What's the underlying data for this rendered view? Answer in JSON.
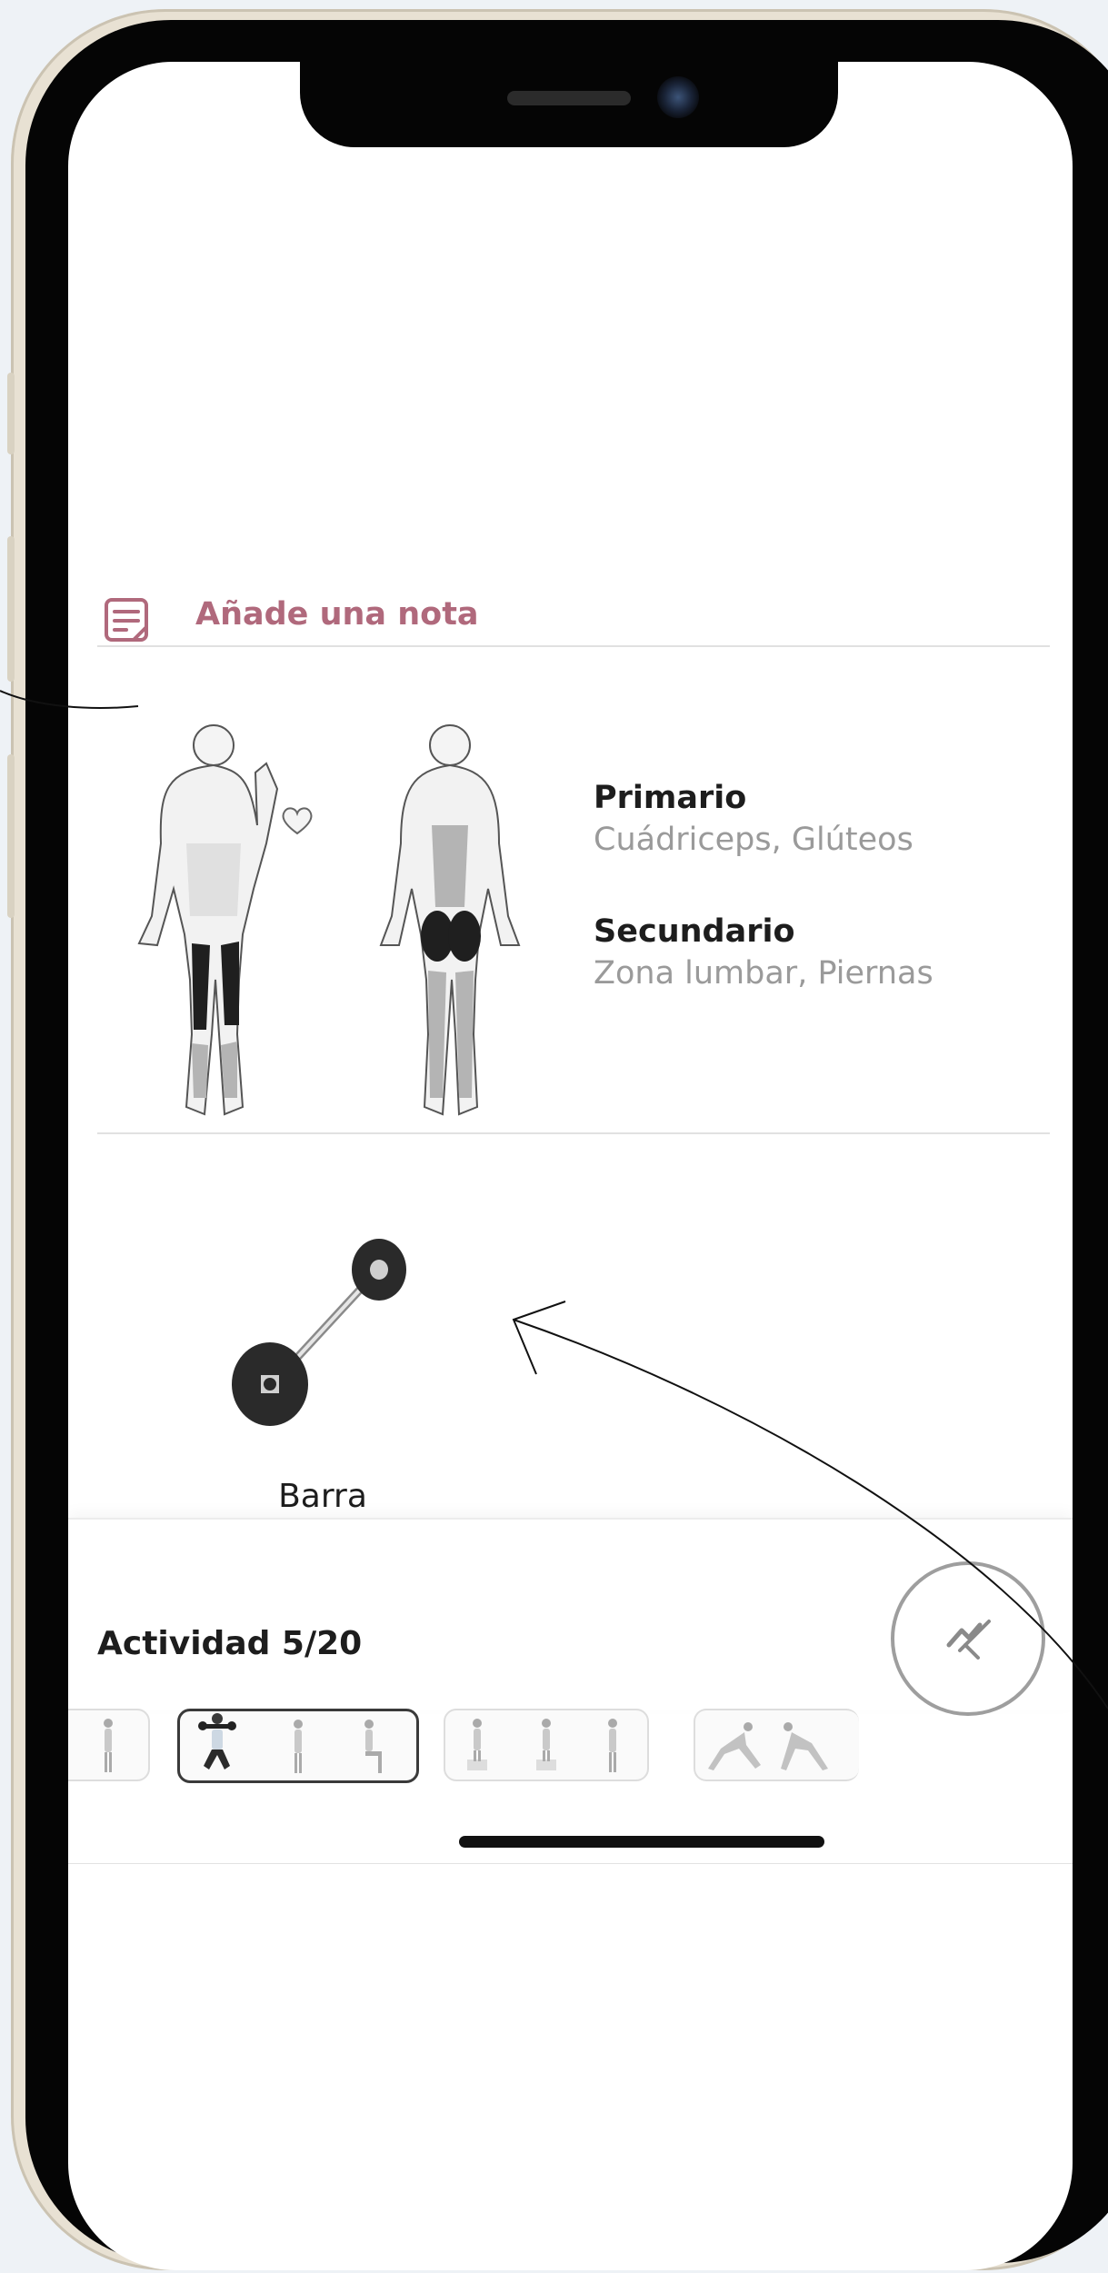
{
  "note": {
    "label": "Añade una nota"
  },
  "muscles": {
    "primary_title": "Primario",
    "primary_value": "Cuádriceps, Glúteos",
    "secondary_title": "Secundario",
    "secondary_value": "Zona lumbar, Piernas"
  },
  "equipment": {
    "label": "Barra"
  },
  "activity": {
    "label": "Actividad 5/20",
    "current": 5,
    "total": 20
  },
  "colors": {
    "accent": "#b0697c",
    "muscle_primary": "#1f1f1f",
    "muscle_secondary": "#b4b4b4"
  },
  "icons": [
    "note-icon",
    "heart-icon",
    "barbell-icon",
    "finish-flag-icon"
  ]
}
